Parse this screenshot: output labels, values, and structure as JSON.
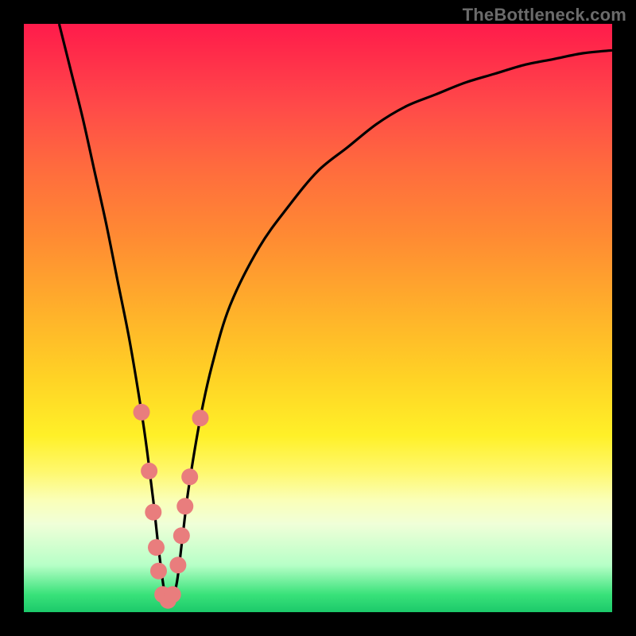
{
  "watermark": {
    "text": "TheBottleneck.com"
  },
  "colors": {
    "frame": "#000000",
    "curve": "#000000",
    "marker": "#e97d7d",
    "gradient_stops": [
      "#ff1b4b",
      "#ff2f4a",
      "#ff4a49",
      "#ff6a3e",
      "#ff8a33",
      "#ffae2b",
      "#ffd225",
      "#fff028",
      "#fff86c",
      "#faffb8",
      "#f0ffd8",
      "#b7ffc7",
      "#39e27a",
      "#1cc96a"
    ]
  },
  "chart_data": {
    "type": "line",
    "title": "",
    "xlabel": "",
    "ylabel": "",
    "xlim": [
      0,
      100
    ],
    "ylim": [
      0,
      100
    ],
    "x": [
      6,
      8,
      10,
      12,
      14,
      16,
      18,
      20,
      21,
      22,
      23,
      24,
      25,
      26,
      27,
      28,
      30,
      32,
      35,
      40,
      45,
      50,
      55,
      60,
      65,
      70,
      75,
      80,
      85,
      90,
      95,
      100
    ],
    "values": [
      100,
      92,
      84,
      75,
      66,
      56,
      46,
      34,
      27,
      19,
      10,
      3,
      2,
      5,
      13,
      21,
      33,
      42,
      52,
      62,
      69,
      75,
      79,
      83,
      86,
      88,
      90,
      91.5,
      93,
      94,
      95,
      95.5
    ],
    "series": [
      {
        "name": "bottleneck-curve",
        "x": [
          6,
          8,
          10,
          12,
          14,
          16,
          18,
          20,
          21,
          22,
          23,
          24,
          25,
          26,
          27,
          28,
          30,
          32,
          35,
          40,
          45,
          50,
          55,
          60,
          65,
          70,
          75,
          80,
          85,
          90,
          95,
          100
        ],
        "y": [
          100,
          92,
          84,
          75,
          66,
          56,
          46,
          34,
          27,
          19,
          10,
          3,
          2,
          5,
          13,
          21,
          33,
          42,
          52,
          62,
          69,
          75,
          79,
          83,
          86,
          88,
          90,
          91.5,
          93,
          94,
          95,
          95.5
        ]
      }
    ],
    "markers": [
      {
        "x": 20.0,
        "y": 34
      },
      {
        "x": 21.3,
        "y": 24
      },
      {
        "x": 22.0,
        "y": 17
      },
      {
        "x": 22.5,
        "y": 11
      },
      {
        "x": 22.9,
        "y": 7
      },
      {
        "x": 23.6,
        "y": 3
      },
      {
        "x": 24.5,
        "y": 2
      },
      {
        "x": 25.3,
        "y": 3
      },
      {
        "x": 26.2,
        "y": 8
      },
      {
        "x": 26.8,
        "y": 13
      },
      {
        "x": 27.4,
        "y": 18
      },
      {
        "x": 28.2,
        "y": 23
      },
      {
        "x": 30.0,
        "y": 33
      }
    ]
  }
}
